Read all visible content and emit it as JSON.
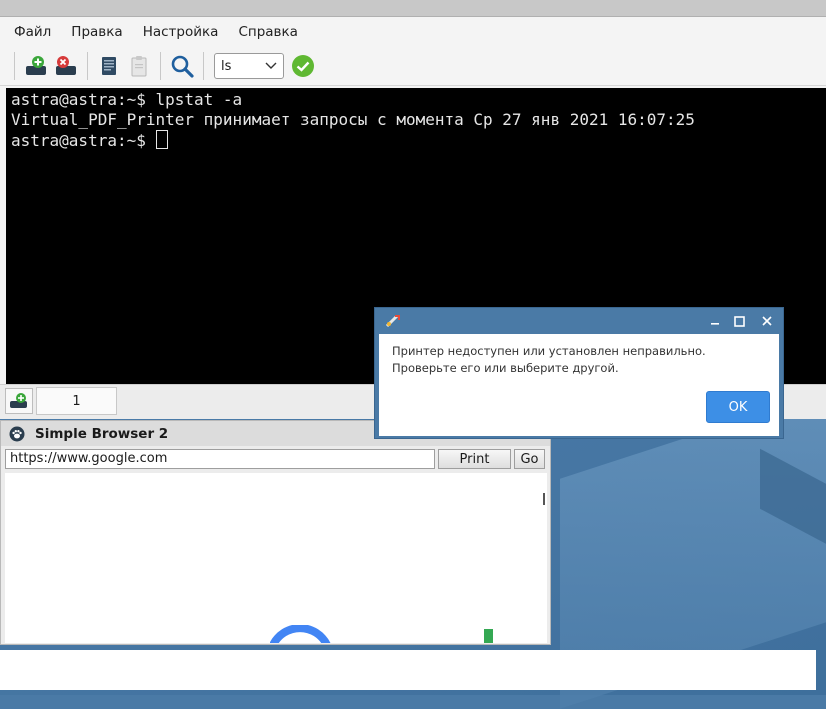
{
  "menu": [
    "Файл",
    "Правка",
    "Настройка",
    "Справка"
  ],
  "toolbar": {
    "command_value": "ls"
  },
  "terminal": {
    "lines": [
      "astra@astra:~$ lpstat -a",
      "Virtual_PDF_Printer принимает запросы с момента Ср 27 янв 2021 16:07:25",
      "astra@astra:~$ "
    ]
  },
  "tabs": {
    "tab1_label": "1"
  },
  "browser": {
    "title": "Simple Browser 2",
    "url": "https://www.google.com",
    "print_label": "Print",
    "go_label": "Go"
  },
  "dialog": {
    "message_line1": "Принтер недоступен или установлен неправильно.",
    "message_line2": "Проверьте его или выберите другой.",
    "ok_label": "OK"
  },
  "colors": {
    "accent": "#3d8fe6",
    "desktop": "#4a7aa6",
    "terminal_bg": "#000000"
  }
}
